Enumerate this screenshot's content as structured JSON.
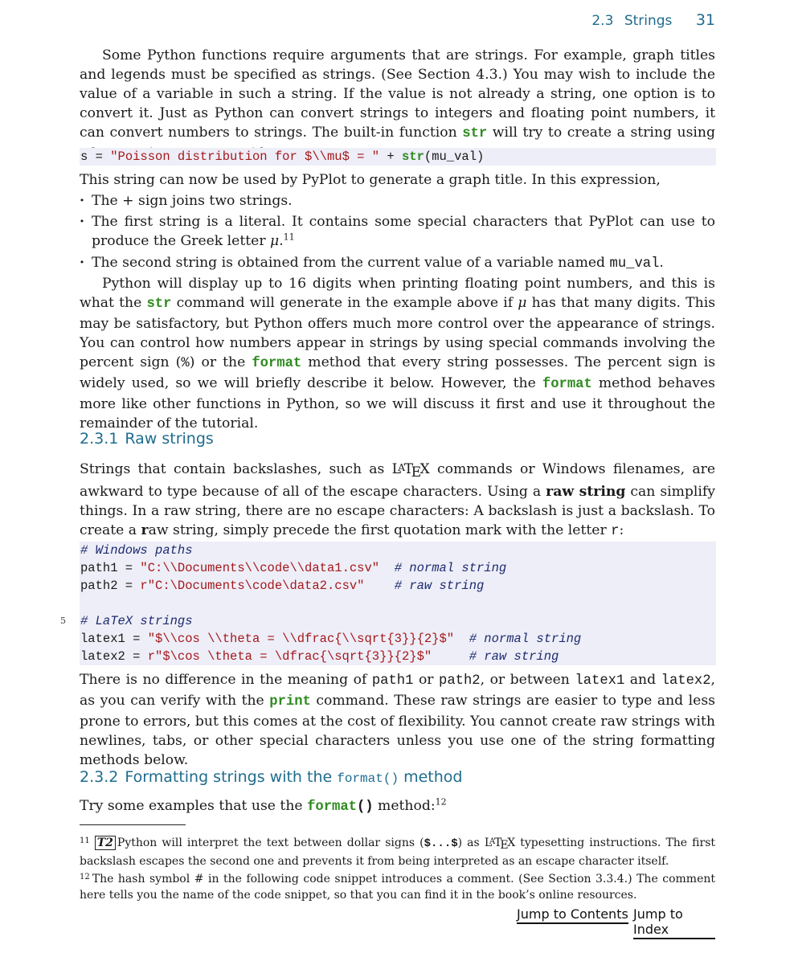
{
  "header": {
    "section_number": "2.3",
    "section_title": "Strings",
    "page_number": "31"
  },
  "intro_paragraph": {
    "part1": "Some Python functions require arguments that are strings. For example, graph titles and legends must be specified as strings. (See Section 4.3.) You may wish to include the value of a variable in such a string. If the value is not already a string, one option is to convert it. Just as Python can convert strings to integers and floating point numbers, it can convert numbers to strings. The built-in function ",
    "keyword": "str",
    "part2": " will try to create a string using whatever input you provide:"
  },
  "code1": {
    "var": "s = ",
    "string": "\"Poisson distribution for $\\\\mu$ = \"",
    "plus": " + ",
    "fn": "str",
    "args": "(mu_val)"
  },
  "after_code1": "This string can now be used by PyPlot to generate a graph title. In this expression,",
  "bullets": [
    {
      "text": "The + sign joins two strings."
    },
    {
      "text": "The first string is a literal. It contains some special characters that PyPlot can use to produce the Greek letter ",
      "math": "μ",
      "tail": ".",
      "footnote_ref": "11"
    },
    {
      "text": "The second string is obtained from the current value of a variable named ",
      "code": "mu_val",
      "tail": "."
    }
  ],
  "paragraph2": {
    "a": "Python will display up to 16 digits when printing floating point numbers, and this is what the ",
    "kw1": "str",
    "b": " command will generate in the example above if ",
    "math": "μ",
    "c": " has that many digits. This may be satisfactory, but Python offers much more control over the appearance of strings. You can control how numbers appear in strings by using special commands involving the percent sign (",
    "pct": "%",
    "d": ") or the ",
    "kw2": "format",
    "e": " method that every string possesses. The percent sign is widely used, so we will briefly describe it below. However, the ",
    "kw3": "format",
    "f": " method behaves more like other functions in Python, so we will discuss it first and use it throughout the remainder of the tutorial."
  },
  "section_231": {
    "number": "2.3.1",
    "title": "Raw strings"
  },
  "paragraph3": {
    "a": "Strings that contain backslashes, such as ",
    "latex": "LaTeX",
    "b": " commands or Windows filenames, are awkward to type because of all of the escape characters. Using a ",
    "bold": "raw string",
    "c": " can simplify things. In a raw string, there are no escape characters: A backslash is just a backslash. To create a ",
    "bold_r": "r",
    "d": "aw string, simply precede the first quotation mark with the letter ",
    "code": "r",
    "e": ":"
  },
  "code2": {
    "line_number_label": "5",
    "lines": [
      {
        "comment": "# Windows paths"
      },
      {
        "var": "path1 = ",
        "string": "\"C:\\\\Documents\\\\code\\\\data1.csv\"",
        "pad": "  ",
        "comment": "# normal string"
      },
      {
        "var": "path2 = ",
        "string": "r\"C:\\Documents\\code\\data2.csv\"",
        "pad": "    ",
        "comment": "# raw string"
      },
      {},
      {
        "comment": "# LaTeX strings"
      },
      {
        "var": "latex1 = ",
        "string": "\"$\\\\cos \\\\theta = \\\\dfrac{\\\\sqrt{3}}{2}$\"",
        "pad": "  ",
        "comment": "# normal string"
      },
      {
        "var": "latex2 = ",
        "string": "r\"$\\cos \\theta = \\dfrac{\\sqrt{3}}{2}$\"",
        "pad": "     ",
        "comment": "# raw string"
      }
    ]
  },
  "paragraph4": {
    "a": "There is no difference in the meaning of ",
    "c1": "path1",
    "b": " or ",
    "c2": "path2",
    "c": ", or between ",
    "c3": "latex1",
    "d": " and ",
    "c4": "latex2",
    "e": ", as you can verify with the ",
    "kw": "print",
    "f": " command. These raw strings are easier to type and less prone to errors, but this comes at the cost of flexibility. You cannot create raw strings with newlines, tabs, or other special characters unless you use one of the string formatting methods below."
  },
  "section_232": {
    "number": "2.3.2",
    "title_a": "Formatting strings with the ",
    "title_code": "format()",
    "title_b": " method"
  },
  "paragraph5": {
    "a": "Try some examples that use the ",
    "kw": "format",
    "parens": "()",
    "b": " method:",
    "footnote_ref": "12"
  },
  "footnotes": [
    {
      "mark": "11",
      "badge": "T2",
      "a": "Python will interpret the text between dollar signs (",
      "code": "$...$",
      "b": ") as ",
      "latex": "LaTeX",
      "c": " typesetting instructions. The first backslash escapes the second one and prevents it from being interpreted as an escape character itself."
    },
    {
      "mark": "12",
      "text": "The hash symbol # in the following code snippet introduces a comment. (See Section 3.3.4.) The comment here tells you the name of the code snippet, so that you can find it in the book’s online resources."
    }
  ],
  "navigation": {
    "contents_link": "Jump to Contents",
    "index_link": "Jump to Index"
  },
  "colors": {
    "heading": "#1f6c8e",
    "keyword": "#2e8b1f",
    "string": "#a3191b",
    "comment": "#1c2b6e",
    "code_bg": "#eeeef8"
  }
}
